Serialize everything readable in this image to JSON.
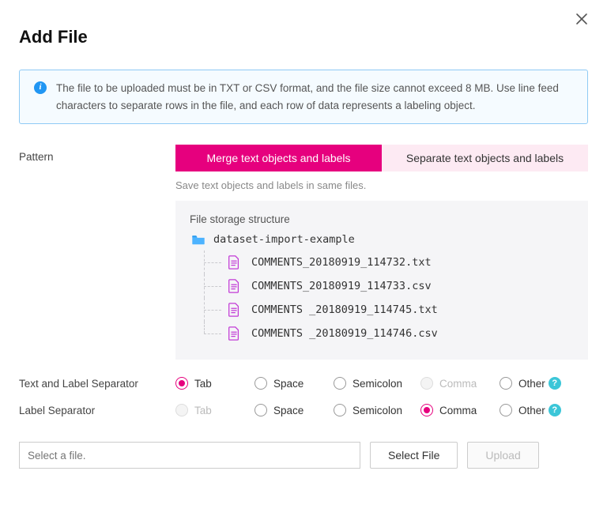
{
  "title": "Add File",
  "info": "The file to be uploaded must be in TXT or CSV format, and the file size cannot exceed 8 MB. Use line feed characters to separate rows in the file, and each row of data represents a labeling object.",
  "pattern": {
    "label": "Pattern",
    "tabs": [
      "Merge text objects and labels",
      "Separate text objects and labels"
    ],
    "active": 0,
    "note": "Save text objects and labels in same files."
  },
  "structure": {
    "title": "File storage structure",
    "folder": "dataset-import-example",
    "files": [
      "COMMENTS_20180919_114732.txt",
      "COMMENTS_20180919_114733.csv",
      "COMMENTS _20180919_114745.txt",
      "COMMENTS _20180919_114746.csv"
    ]
  },
  "sep1": {
    "label": "Text and Label Separator",
    "options": [
      "Tab",
      "Space",
      "Semicolon",
      "Comma",
      "Other"
    ],
    "selected": "Tab",
    "disabled": [
      "Comma"
    ]
  },
  "sep2": {
    "label": "Label Separator",
    "options": [
      "Tab",
      "Space",
      "Semicolon",
      "Comma",
      "Other"
    ],
    "selected": "Comma",
    "disabled": [
      "Tab"
    ]
  },
  "filebar": {
    "placeholder": "Select a file.",
    "select_btn": "Select File",
    "upload_btn": "Upload"
  }
}
